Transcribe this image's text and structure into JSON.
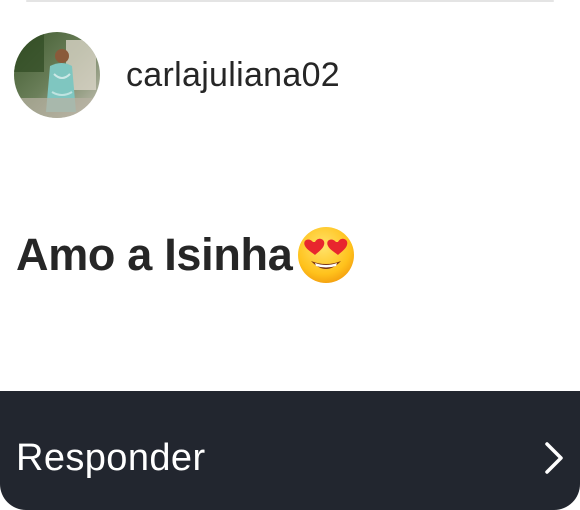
{
  "comment_card": {
    "username": "carlajuliana02",
    "comment_text": "Amo a Isinha",
    "emoji": "smiling-face-with-heart-eyes",
    "reply_button": {
      "label": "Responder",
      "icon": "chevron-right-icon"
    }
  },
  "colors": {
    "text": "#262626",
    "reply_bar_bg": "#22262f",
    "reply_text": "#ffffff"
  }
}
